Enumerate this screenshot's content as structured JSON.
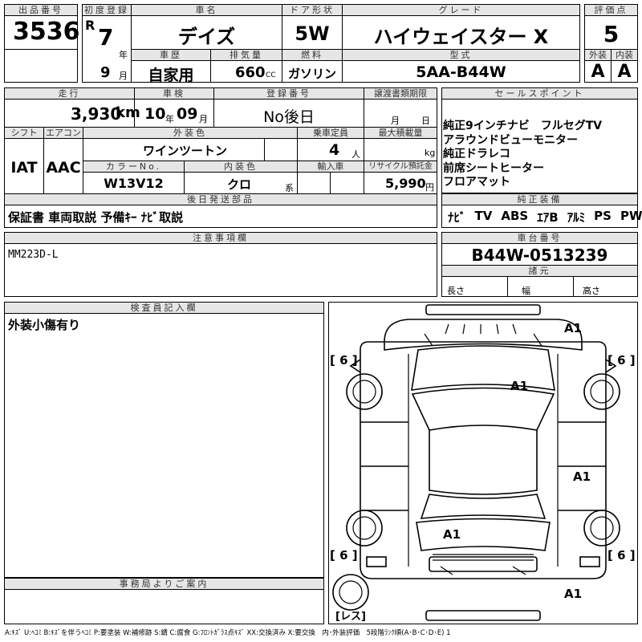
{
  "labels": {
    "lot_no": "出品番号",
    "first_reg": "初度登録",
    "car_name": "車名",
    "door_type": "ドア形状",
    "grade": "グレード",
    "score": "評価点",
    "history": "車歴",
    "displacement": "排気量",
    "fuel": "燃料",
    "model_code": "型式",
    "exterior": "外装",
    "interior": "内装",
    "mileage": "走行",
    "inspection": "車検",
    "registration": "登録番号",
    "transfer_deadline": "譲渡書類期限",
    "sales_point": "セールスポイント",
    "shift": "シフト",
    "aircon": "エアコン",
    "ext_color": "外装色",
    "capacity": "乗車定員",
    "max_load": "最大積載量",
    "color_no": "カラーNo.",
    "int_color": "内装色",
    "import": "輸入車",
    "recycle": "リサイクル預託金",
    "later_parts": "後日発送部品",
    "factory_equip": "純正装備",
    "notes": "注意事項欄",
    "chassis": "車台番号",
    "dims": "諸元",
    "length": "長さ",
    "width": "幅",
    "height": "高さ",
    "inspector": "検査員記入欄",
    "office": "事務局よりご案内"
  },
  "vehicle": {
    "lot_no": "3536",
    "era": "R",
    "year": "7",
    "year_unit": "年",
    "month": "9",
    "month_unit": "月",
    "car_name": "デイズ",
    "door": "5W",
    "grade": "ハイウェイスター X",
    "score": "5",
    "history": "自家用",
    "displacement": "660",
    "cc": "CC",
    "fuel": "ガソリン",
    "model_code": "5AA-B44W",
    "ext_score": "A",
    "int_score": "A",
    "mileage": "3,930",
    "km": "km",
    "insp_year": "10",
    "insp_year_unit": "年",
    "insp_month": "09",
    "insp_month_unit": "月",
    "registration": "No後日",
    "transfer_month": "月",
    "transfer_day": "日",
    "shift": "IAT",
    "aircon": "AAC",
    "ext_color": "ツートン",
    "ext_color_prefix": "ワイン",
    "capacity": "4",
    "capacity_unit": "人",
    "load_unit": "kg",
    "color_no": "W13V12",
    "int_color": "クロ",
    "int_color_unit": "系",
    "recycle": "5,990",
    "recycle_unit": "円",
    "chassis": "B44W-0513239"
  },
  "sales_points": [
    "純正9インチナビ　フルセグTV",
    "アラウンドビューモニター",
    "純正ドラレコ",
    "前席シートヒーター",
    "フロアマット"
  ],
  "later_parts": "保証書 車両取説 予備ｷｰ ﾅﾋﾞ取説",
  "equipment": [
    "ﾅﾋﾞ",
    "TV",
    "ABS",
    "ｴｱB",
    "ｱﾙﾐ",
    "PS",
    "PW"
  ],
  "notes_text": "MM223D-L",
  "inspector_text": "外装小傷有り",
  "diagram": {
    "marks": [
      "A1",
      "A1",
      "A1",
      "A1",
      "A1"
    ],
    "tires": [
      "[ 6 ]",
      "[ 6 ]",
      "[ 6 ]",
      "[ 6 ]"
    ],
    "spare": "[レス]"
  },
  "legend": "A:ｷｽﾞ U:ﾍｺﾐ B:ｷｽﾞを伴うﾍｺﾐ P:要塗装 W:補修跡 S:錆 C:腐食 G:ﾌﾛﾝﾄｶﾞﾗｽ点ｷｽﾞ XX:交換済み X:要交換　内･外装評価　5段階ﾗﾝｸ順(A･B･C･D･E) 1"
}
